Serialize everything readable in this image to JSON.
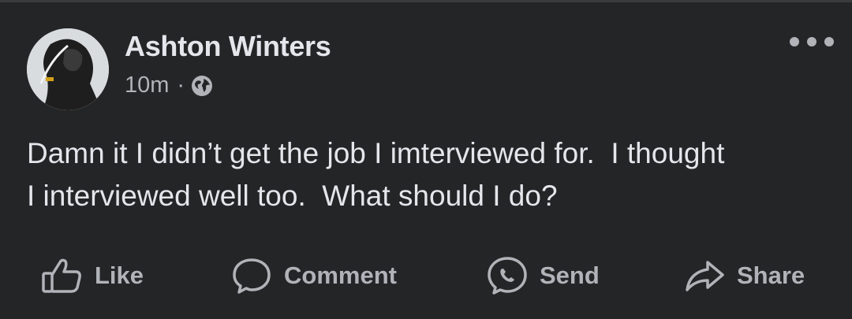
{
  "post": {
    "author": "Ashton Winters",
    "time": "10m",
    "separator": "·",
    "privacy_icon": "globe-icon",
    "text": "Damn it I didn’t get the job I imterviewed for.  I thought\nI interviewed well too.  What should I do?"
  },
  "actions": {
    "like": "Like",
    "comment": "Comment",
    "send": "Send",
    "share": "Share"
  },
  "colors": {
    "background": "#242526",
    "text_primary": "#e4e6eb",
    "text_secondary": "#b0b3b8"
  }
}
